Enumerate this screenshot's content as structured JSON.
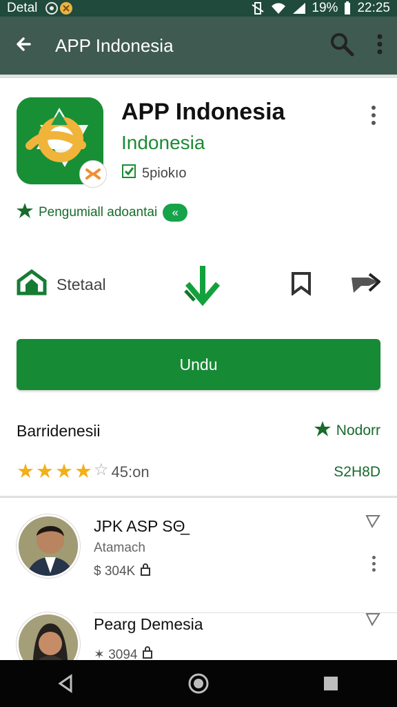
{
  "status": {
    "carrier": "Detal",
    "battery": "19%",
    "time": "22:25"
  },
  "appbar": {
    "title": "APP Indonesia"
  },
  "app": {
    "name": "APP Indonesia",
    "publisher": "Indonesia",
    "tag": "5piokıo",
    "editors_choice": "Pengumiall adoantai",
    "editors_badge": "«",
    "action_label": "Stetaal",
    "install_label": "Undu"
  },
  "ratings": {
    "heading": "Barridenesii",
    "more_label": "Nodorr",
    "score": "45:on",
    "code": "S2H8D",
    "stars_filled": 4
  },
  "list": [
    {
      "title": "JPK ASP SΘ̲",
      "subtitle": "Atamach",
      "meta": "$ 304K"
    },
    {
      "title": "Pearg Demesia",
      "subtitle": "",
      "meta": "✶ 3094"
    }
  ],
  "icons": {
    "back": "arrow-left-icon",
    "search": "search-icon",
    "overflow": "more-vert-icon"
  },
  "colors": {
    "accent": "#168a35",
    "appbar": "#3f5a50",
    "status": "#1f4a3c"
  }
}
